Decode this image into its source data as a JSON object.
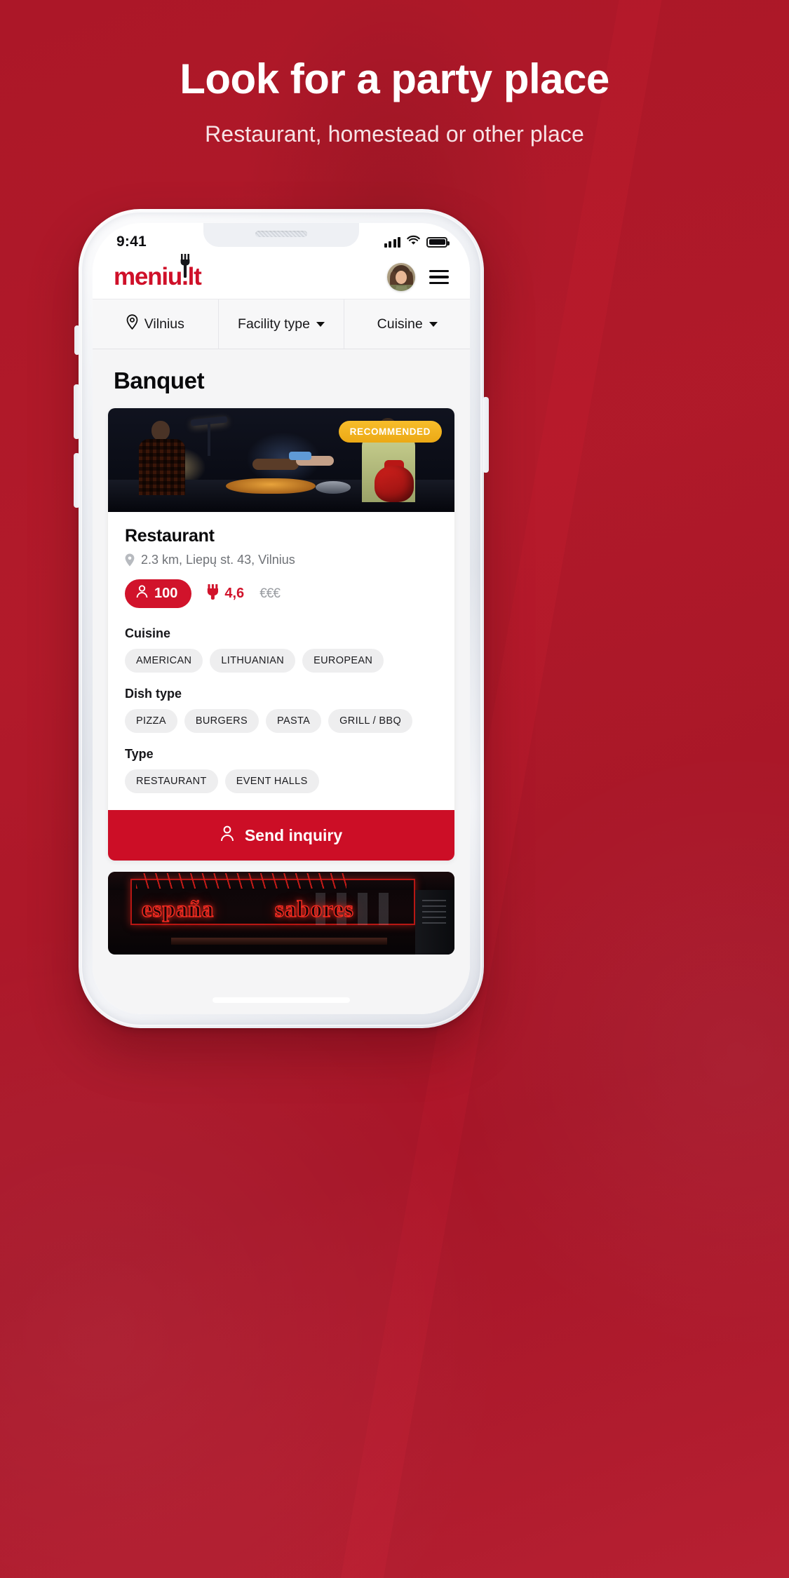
{
  "hero": {
    "title": "Look for a party place",
    "subtitle": "Restaurant, homestead or other place"
  },
  "colors": {
    "brand_red": "#cf1029",
    "page_bg": "#b5182a",
    "badge_gold": "#eca915",
    "cta_red": "#cc0e26",
    "tag_gray": "#eeeeef"
  },
  "phone": {
    "status_bar": {
      "time": "9:41",
      "icons": [
        "signal-icon",
        "wifi-icon",
        "battery-icon"
      ]
    },
    "app_header": {
      "logo_text": "meniu.lt",
      "logo_icon": "fork-icon",
      "avatar_name": "avatar",
      "menu_icon": "hamburger-menu-icon"
    },
    "filters": [
      {
        "label": "Vilnius",
        "icon": "location-pin-icon",
        "has_caret": false
      },
      {
        "label": "Facility type",
        "icon": "",
        "has_caret": true
      },
      {
        "label": "Cuisine",
        "icon": "",
        "has_caret": true
      }
    ],
    "page_title": "Banquet",
    "card": {
      "badge": "RECOMMENDED",
      "photo_alt": "street-food-stall-photo",
      "name": "Restaurant",
      "address": "2.3 km, Liepų st. 43, Vilnius",
      "capacity": "100",
      "capacity_icon": "person-icon",
      "rating": "4,6",
      "rating_icon": "fork-rating-icon",
      "price_level": "€€€",
      "groups": [
        {
          "label": "Cuisine",
          "tags": [
            "AMERICAN",
            "LITHUANIAN",
            "EUROPEAN"
          ]
        },
        {
          "label": "Dish type",
          "tags": [
            "PIZZA",
            "BURGERS",
            "PASTA",
            "GRILL / BBQ"
          ]
        },
        {
          "label": "Type",
          "tags": [
            "RESTAURANT",
            "EVENT HALLS"
          ]
        }
      ],
      "cta_label": "Send inquiry",
      "cta_icon": "person-icon"
    },
    "card2": {
      "photo_alt": "neon-sign-photo",
      "neon_text_1": "españa",
      "neon_text_2": "sabores"
    }
  }
}
